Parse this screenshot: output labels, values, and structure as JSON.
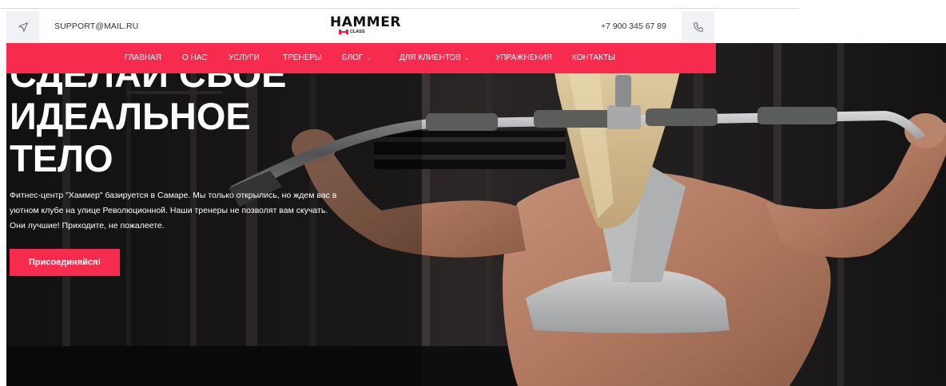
{
  "topbar": {
    "email": "SUPPORT@MAIL.RU",
    "phone": "+7 900 345 67 89",
    "left_icon": "location-arrow-icon",
    "right_icon": "phone-icon"
  },
  "logo": {
    "main": "HAMMER",
    "sub": "CLASS"
  },
  "nav": {
    "items": [
      {
        "label": "ГЛАВНАЯ"
      },
      {
        "label": "О НАС"
      },
      {
        "label": "УСЛУГИ"
      },
      {
        "label": "ТРЕНЕРЫ"
      },
      {
        "label": "БЛОГ",
        "dropdown": true
      },
      {
        "label": "ДЛЯ КЛИЕНТОВ",
        "dropdown": true
      },
      {
        "label": "УПРАЖНЕНИЯ"
      },
      {
        "label": "КОНТАКТЫ"
      }
    ],
    "chevron": "⌄"
  },
  "hero": {
    "headline_lines": [
      "СДЕЛАЙ СВОЕ",
      "ИДЕАЛЬНОЕ",
      "ТЕЛО"
    ],
    "description": "Фитнес-центр \"Хаммер\" базируется в Самаре. Мы только открылись, но ждем вас в уютном клубе на улице Революционной. Наши тренеры не позволят вам скучать. Они лучшие! Приходите, не пожалеете.",
    "cta_label": "Присоединяйся!"
  },
  "colors": {
    "accent": "#f72b4e",
    "hero_bg": "#151414",
    "icon_box": "#f1f2f5"
  }
}
